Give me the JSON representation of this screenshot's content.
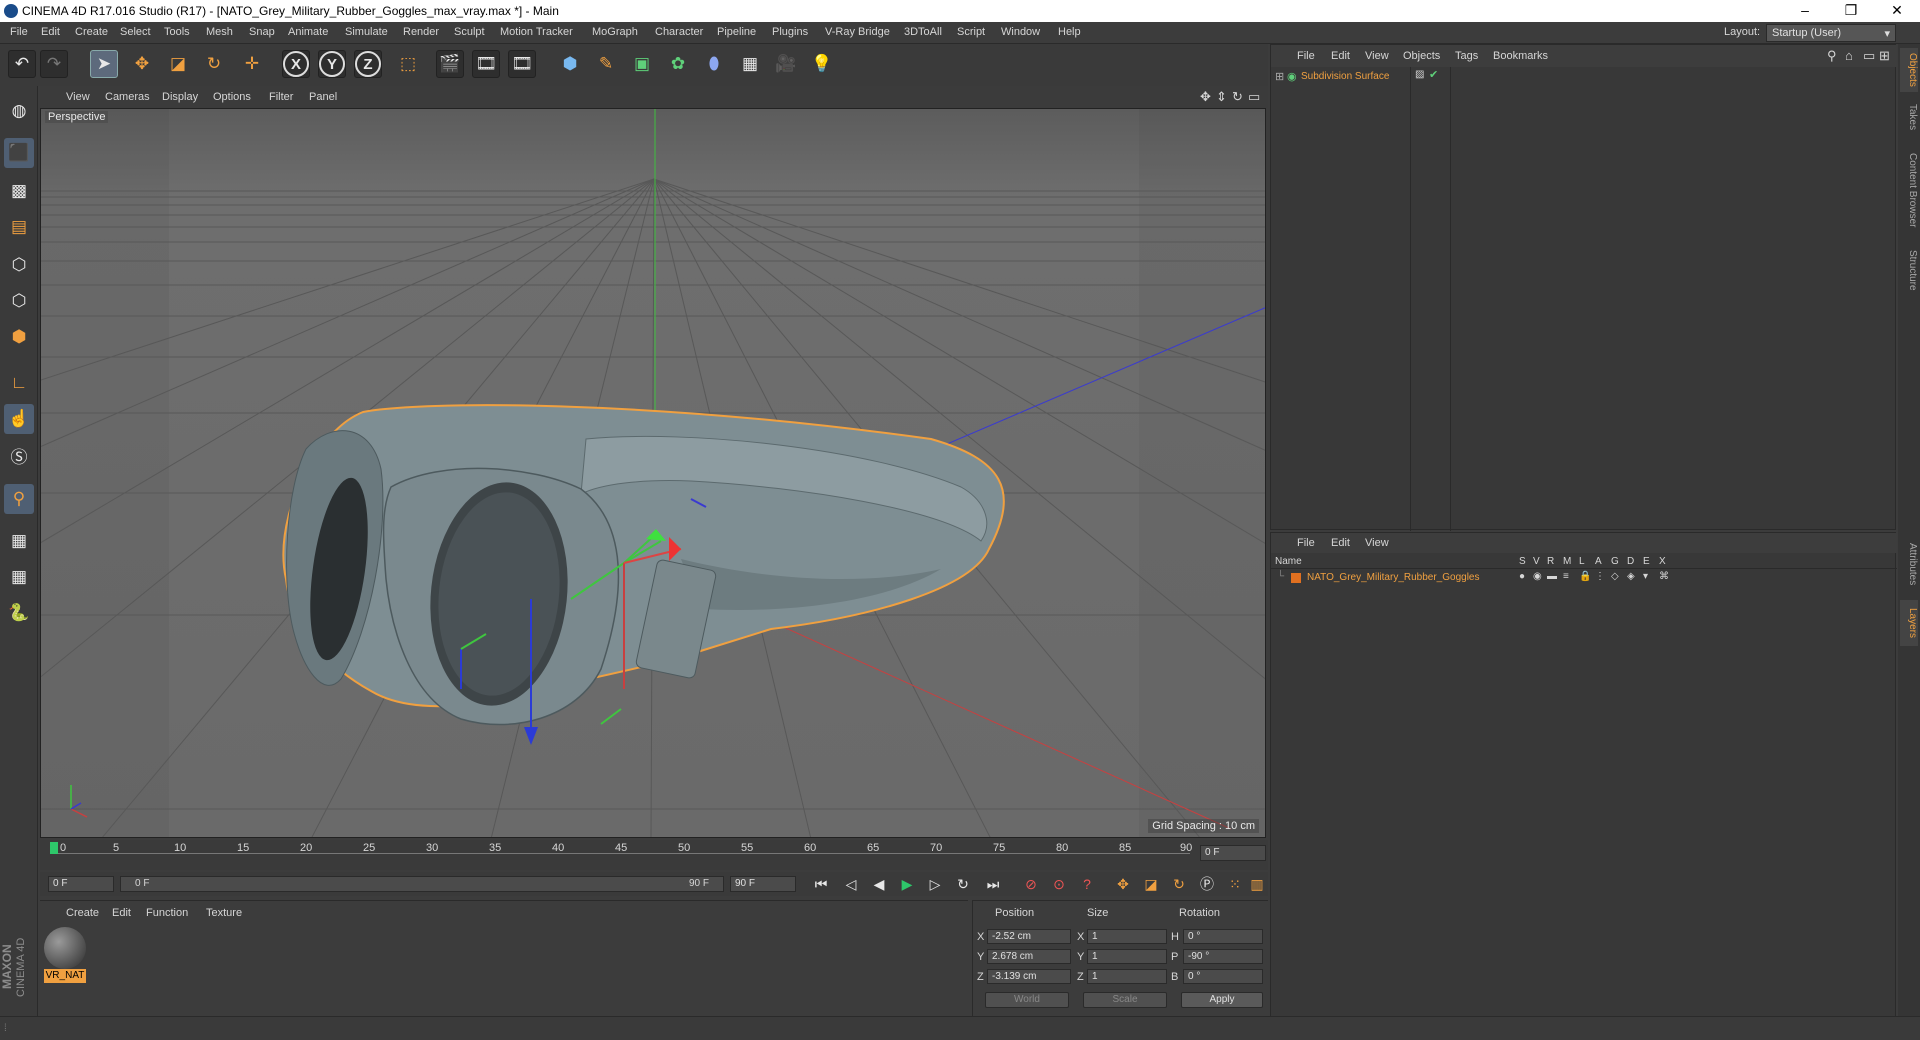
{
  "window": {
    "title": "CINEMA 4D R17.016 Studio (R17) - [NATO_Grey_Military_Rubber_Goggles_max_vray.max *] - Main",
    "minimize": "–",
    "maximize": "❐",
    "close": "✕"
  },
  "menubar": {
    "items": [
      "File",
      "Edit",
      "Create",
      "Select",
      "Tools",
      "Mesh",
      "Snap",
      "Animate",
      "Simulate",
      "Render",
      "Sculpt",
      "Motion Tracker",
      "MoGraph",
      "Character",
      "Pipeline",
      "Plugins",
      "V-Ray Bridge",
      "3DToAll",
      "Script",
      "Window",
      "Help"
    ],
    "layout_label": "Layout:",
    "layout_value": "Startup (User)"
  },
  "toolbar": {
    "x_label": "X",
    "y_label": "Y",
    "z_label": "Z"
  },
  "viewport": {
    "menu": [
      "View",
      "Cameras",
      "Display",
      "Options",
      "Filter",
      "Panel"
    ],
    "label": "Perspective",
    "grid_spacing": "Grid Spacing : 10 cm"
  },
  "timeline": {
    "ticks": [
      "0",
      "5",
      "10",
      "15",
      "20",
      "25",
      "30",
      "35",
      "40",
      "45",
      "50",
      "55",
      "60",
      "65",
      "70",
      "75",
      "80",
      "85",
      "90"
    ],
    "current_frame_right": "0 F",
    "start_field": "0 F",
    "range_start": "0 F",
    "range_end": "90 F",
    "end_field": "90 F"
  },
  "materials": {
    "menu": [
      "Create",
      "Edit",
      "Function",
      "Texture"
    ],
    "items": [
      {
        "name": "VR_NAT"
      }
    ]
  },
  "coordinates": {
    "headers": {
      "position": "Position",
      "size": "Size",
      "rotation": "Rotation"
    },
    "rows": [
      {
        "axis": "X",
        "pos": "-2.52 cm",
        "size_axis": "X",
        "size": "1",
        "rot_axis": "H",
        "rot": "0 °"
      },
      {
        "axis": "Y",
        "pos": "2.678 cm",
        "size_axis": "Y",
        "size": "1",
        "rot_axis": "P",
        "rot": "-90 °"
      },
      {
        "axis": "Z",
        "pos": "-3.139 cm",
        "size_axis": "Z",
        "size": "1",
        "rot_axis": "B",
        "rot": "0 °"
      }
    ],
    "mode": "World",
    "scale": "Scale",
    "apply": "Apply"
  },
  "objects": {
    "menu": [
      "File",
      "Edit",
      "View",
      "Objects",
      "Tags",
      "Bookmarks"
    ],
    "items": [
      {
        "name": "Subdivision Surface",
        "color": "#f0a040"
      }
    ]
  },
  "layers": {
    "menu": [
      "File",
      "Edit",
      "View"
    ],
    "name_header": "Name",
    "col_headers": [
      "S",
      "V",
      "R",
      "M",
      "L",
      "A",
      "G",
      "D",
      "E",
      "X"
    ],
    "items": [
      {
        "name": "NATO_Grey_Military_Rubber_Goggles",
        "color": "#e07020"
      }
    ]
  },
  "right_tabs": [
    "Objects",
    "Takes",
    "Content Browser",
    "Structure",
    "Attributes",
    "Layers"
  ],
  "brand": {
    "line1": "MAXON",
    "line2": "CINEMA 4D"
  },
  "colors": {
    "accent_orange": "#f0a040",
    "viewport_bg": "#6b6b6b",
    "selection_outline": "#f0a040"
  }
}
